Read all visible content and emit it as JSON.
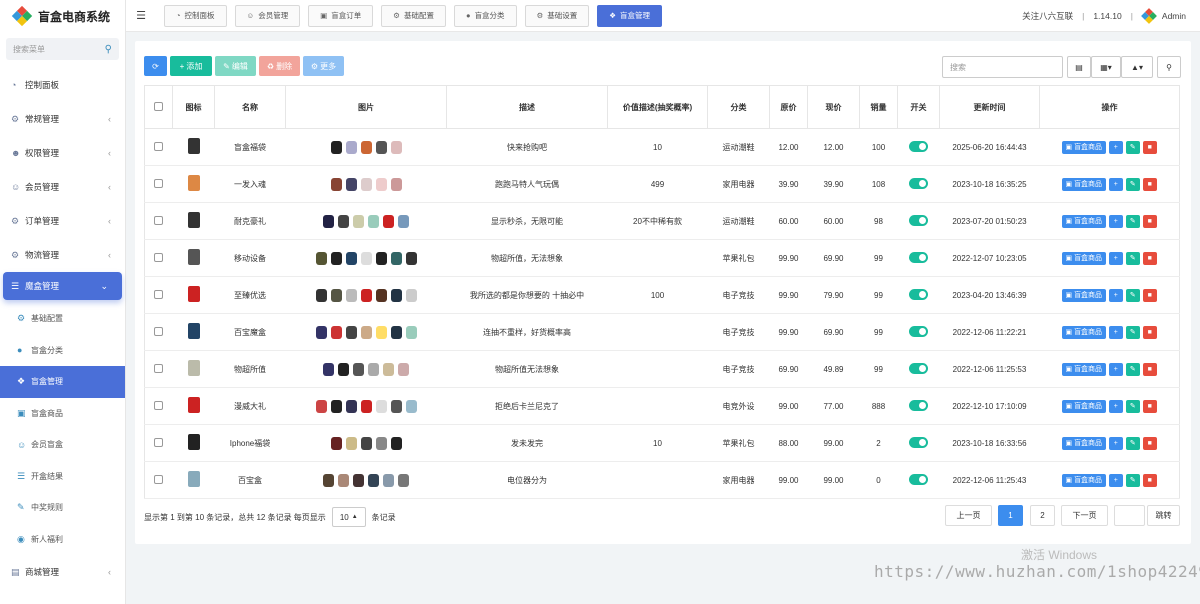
{
  "app": {
    "title": "盲盒电商系统",
    "logo_colors": [
      "#e74c3c",
      "#27ae60",
      "#3498db",
      "#f1c40f"
    ]
  },
  "sidebar": {
    "search_placeholder": "搜索菜单",
    "items": [
      {
        "label": "控制面板",
        "icon": "dashboard-icon",
        "chevron": false
      },
      {
        "label": "常规管理",
        "icon": "cogs-icon",
        "chevron": true
      },
      {
        "label": "权限管理",
        "icon": "users-icon",
        "chevron": true
      },
      {
        "label": "会员管理",
        "icon": "user-icon",
        "chevron": true
      },
      {
        "label": "订单管理",
        "icon": "cogs-icon",
        "chevron": true
      },
      {
        "label": "物流管理",
        "icon": "cogs-icon",
        "chevron": true
      },
      {
        "label": "魔盒管理",
        "icon": "list-icon",
        "chevron": true,
        "open": true
      },
      {
        "label": "基础配置",
        "icon": "gear-icon",
        "sub": true
      },
      {
        "label": "盲盒分类",
        "icon": "circle-icon",
        "sub": true
      },
      {
        "label": "盲盒管理",
        "icon": "dropbox-icon",
        "sub": true,
        "active": true
      },
      {
        "label": "盲盒商品",
        "icon": "box-icon",
        "sub": true
      },
      {
        "label": "会员盲盒",
        "icon": "user-icon",
        "sub": true
      },
      {
        "label": "开盒结果",
        "icon": "list-icon",
        "sub": true
      },
      {
        "label": "中奖规则",
        "icon": "brush-icon",
        "sub": true
      },
      {
        "label": "新人福利",
        "icon": "bomb-icon",
        "sub": true
      },
      {
        "label": "商城管理",
        "icon": "shop-icon",
        "chevron": true
      }
    ]
  },
  "topbar": {
    "tabs": [
      {
        "label": "控制面板",
        "icon": "dashboard-icon"
      },
      {
        "label": "会员管理",
        "icon": "user-icon"
      },
      {
        "label": "盲盒订单",
        "icon": "box-icon"
      },
      {
        "label": "基础配置",
        "icon": "gear-icon"
      },
      {
        "label": "盲盒分类",
        "icon": "circle-icon"
      },
      {
        "label": "基础设置",
        "icon": "cogs-icon"
      },
      {
        "label": "盲盒管理",
        "icon": "dropbox-icon",
        "active": true
      }
    ],
    "right": {
      "follow": "关注八六互联",
      "version": "1.14.10",
      "user": "Admin"
    }
  },
  "toolbar": {
    "refresh": "",
    "add": "添加",
    "edit": "编辑",
    "delete": "删除",
    "more": "更多",
    "search_placeholder": "搜索"
  },
  "table": {
    "headers": [
      "图标",
      "名称",
      "图片",
      "描述",
      "价值描述(抽奖概率)",
      "分类",
      "原价",
      "现价",
      "销量",
      "开关",
      "更新时间",
      "操作"
    ],
    "op_label": "盲盒商品",
    "rows": [
      {
        "name": "盲盒福袋",
        "desc": "快来抢购吧",
        "value": "10",
        "cat": "运动潮鞋",
        "orig": "12.00",
        "now": "12.00",
        "sales": "100",
        "time": "2025-06-20 16:44:43",
        "icon": "#333",
        "thumbs": [
          "#222",
          "#aac",
          "#c63",
          "#555",
          "#dbb"
        ]
      },
      {
        "name": "一发入魂",
        "desc": "跑跑马特人气玩偶",
        "value": "499",
        "cat": "家用电器",
        "orig": "39.90",
        "now": "39.90",
        "sales": "108",
        "time": "2023-10-18 16:35:25",
        "icon": "#d84",
        "thumbs": [
          "#843",
          "#446",
          "#dcc",
          "#ecc",
          "#c99"
        ]
      },
      {
        "name": "耐克豪礼",
        "desc": "显示秒杀，无限可能",
        "value": "20不中稀有款",
        "cat": "运动潮鞋",
        "orig": "60.00",
        "now": "60.00",
        "sales": "98",
        "time": "2023-07-20 01:50:23",
        "icon": "#333",
        "thumbs": [
          "#224",
          "#444",
          "#cca",
          "#9cb",
          "#c22",
          "#79b"
        ]
      },
      {
        "name": "移动设备",
        "desc": "物超所值，无法想象",
        "value": "",
        "cat": "苹果礼包",
        "orig": "99.90",
        "now": "69.90",
        "sales": "99",
        "time": "2022-12-07 10:23:05",
        "icon": "#555",
        "thumbs": [
          "#553",
          "#222",
          "#246",
          "#ddd",
          "#222",
          "#366",
          "#333"
        ]
      },
      {
        "name": "至臻优选",
        "desc": "我所选的都是你想要的 十抽必中",
        "value": "100",
        "cat": "电子竞技",
        "orig": "99.90",
        "now": "79.90",
        "sales": "99",
        "time": "2023-04-20 13:46:39",
        "icon": "#c22",
        "thumbs": [
          "#333",
          "#554",
          "#bbb",
          "#c22",
          "#532",
          "#234",
          "#ccc"
        ]
      },
      {
        "name": "百宝魔盒",
        "desc": "连抽不重样，好货概率高",
        "value": "",
        "cat": "电子竞技",
        "orig": "99.90",
        "now": "69.90",
        "sales": "99",
        "time": "2022-12-06 11:22:21",
        "icon": "#246",
        "thumbs": [
          "#336",
          "#c33",
          "#444",
          "#ca8",
          "#fd6",
          "#234",
          "#9cb"
        ]
      },
      {
        "name": "物超所值",
        "desc": "物超所值无法想象",
        "value": "",
        "cat": "电子竞技",
        "orig": "69.90",
        "now": "49.89",
        "sales": "99",
        "time": "2022-12-06 11:25:53",
        "icon": "#bba",
        "thumbs": [
          "#336",
          "#222",
          "#555",
          "#aaa",
          "#cb9",
          "#caa"
        ]
      },
      {
        "name": "漫威大礼",
        "desc": "拒绝后卡兰尼克了",
        "value": "",
        "cat": "电竞外设",
        "orig": "99.00",
        "now": "77.00",
        "sales": "888",
        "time": "2022-12-10 17:10:09",
        "icon": "#c22",
        "thumbs": [
          "#c44",
          "#222",
          "#335",
          "#c22",
          "#ddd",
          "#555",
          "#9bc"
        ]
      },
      {
        "name": "Iphone福袋",
        "desc": "发未发完",
        "value": "10",
        "cat": "苹果礼包",
        "orig": "88.00",
        "now": "99.00",
        "sales": "2",
        "time": "2023-10-18 16:33:56",
        "icon": "#222",
        "thumbs": [
          "#622",
          "#cb8",
          "#444",
          "#888",
          "#222"
        ]
      },
      {
        "name": "百宝盒",
        "desc": "电位器分为",
        "value": "",
        "cat": "家用电器",
        "orig": "99.00",
        "now": "99.00",
        "sales": "0",
        "time": "2022-12-06 11:25:43",
        "icon": "#8ab",
        "thumbs": [
          "#543",
          "#a87",
          "#433",
          "#345",
          "#89a",
          "#777"
        ]
      }
    ]
  },
  "pagination": {
    "info_pre": "显示第 1 到第 10 条记录，总共 12 条记录 每页显示",
    "page_size": "10",
    "info_post": "条记录",
    "prev": "上一页",
    "pages": [
      "1",
      "2"
    ],
    "current": "1",
    "next": "下一页",
    "jump": "跳转"
  },
  "watermark": {
    "windows": "激活 Windows",
    "url": "https://www.huzhan.com/1shop42249"
  }
}
